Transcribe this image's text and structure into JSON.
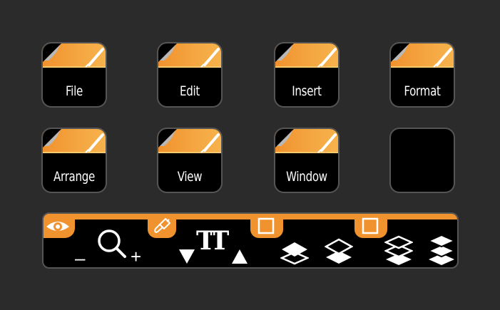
{
  "colors": {
    "accent": "#f0922e",
    "accent_light": "#f7b24c",
    "background": "#2b2b2b",
    "key": "#000000",
    "border": "#555555"
  },
  "keys": [
    {
      "label": "File",
      "icon": "document-pen-icon"
    },
    {
      "label": "Edit",
      "icon": "document-pen-icon"
    },
    {
      "label": "Insert",
      "icon": "document-pen-icon"
    },
    {
      "label": "Format",
      "icon": "document-pen-icon"
    },
    {
      "label": "Arrange",
      "icon": "document-pen-icon"
    },
    {
      "label": "View",
      "icon": "document-pen-icon"
    },
    {
      "label": "Window",
      "icon": "document-pen-icon"
    },
    {
      "label": "",
      "icon": ""
    }
  ],
  "toolbar": {
    "zoom_minus": "–",
    "zoom_plus": "+",
    "text_size_glyph": "TT",
    "icons": [
      "eye-icon",
      "magnifier-icon",
      "brush-icon",
      "text-size-icon",
      "square-icon",
      "layers-icon"
    ]
  }
}
